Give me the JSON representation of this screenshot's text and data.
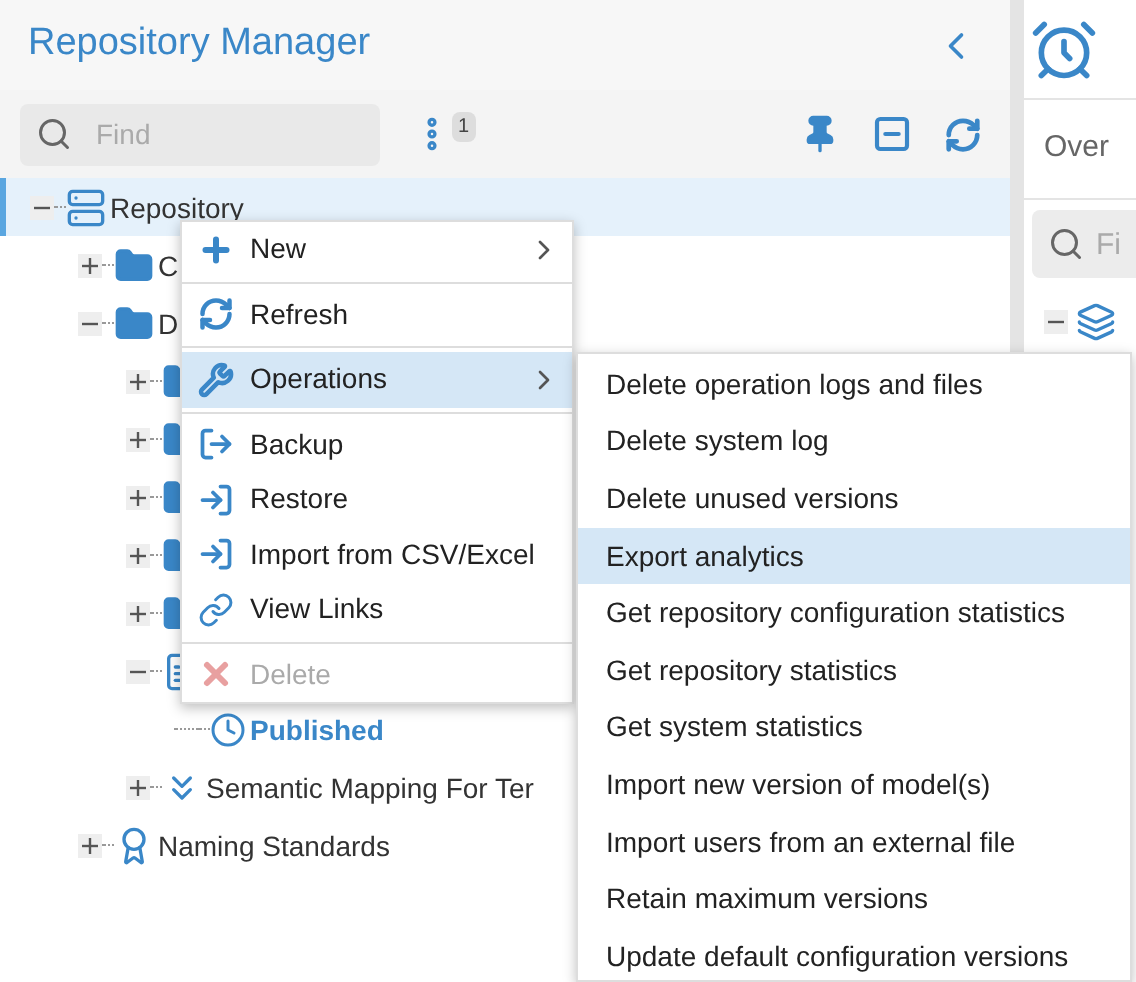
{
  "panel": {
    "title": "Repository Manager",
    "search": {
      "placeholder": "Find"
    },
    "filter_badge": "1"
  },
  "tree": [
    {
      "label": "Repository",
      "kind": "server",
      "expanded": true,
      "selected": true,
      "children": [
        {
          "label": "C",
          "kind": "folder",
          "expanded": false,
          "selected": false
        },
        {
          "label": "D",
          "kind": "folder",
          "expanded": true,
          "selected": false,
          "children": [
            {
              "kind": "folder",
              "expanded": false,
              "selected": false
            },
            {
              "kind": "folder",
              "expanded": false,
              "selected": false
            },
            {
              "kind": "folder",
              "expanded": false,
              "selected": false
            },
            {
              "kind": "folder",
              "expanded": false,
              "selected": false
            },
            {
              "kind": "folder",
              "expanded": false,
              "selected": false
            },
            {
              "kind": "model",
              "expanded": true,
              "selected": false,
              "children": [
                {
                  "label": "Published",
                  "kind": "version",
                  "selected": false
                }
              ]
            },
            {
              "label": "Semantic Mapping For Ter",
              "kind": "mapping",
              "expanded": false,
              "selected": false
            }
          ]
        },
        {
          "label": "Naming Standards",
          "kind": "standard",
          "expanded": false,
          "selected": false
        }
      ]
    }
  ],
  "right_panel": {
    "tab": "Over",
    "search": {
      "placeholder": "Fi"
    }
  },
  "context_menu": {
    "sections": [
      [
        {
          "label": "New",
          "kind": "new",
          "submenu": true,
          "selected": false,
          "disabled": false
        }
      ],
      [
        {
          "label": "Refresh",
          "kind": "refresh",
          "submenu": false,
          "selected": false,
          "disabled": false
        }
      ],
      [
        {
          "label": "Operations",
          "kind": "operations",
          "submenu": true,
          "selected": true,
          "disabled": false
        }
      ],
      [
        {
          "label": "Backup",
          "kind": "backup",
          "submenu": false,
          "selected": false,
          "disabled": false
        },
        {
          "label": "Restore",
          "kind": "restore",
          "submenu": false,
          "selected": false,
          "disabled": false
        },
        {
          "label": "Import from CSV/Excel",
          "kind": "import",
          "submenu": false,
          "selected": false,
          "disabled": false
        },
        {
          "label": "View Links",
          "kind": "links",
          "submenu": false,
          "selected": false,
          "disabled": false
        }
      ],
      [
        {
          "label": "Delete",
          "kind": "delete",
          "submenu": false,
          "selected": false,
          "disabled": true
        }
      ]
    ]
  },
  "submenu": [
    {
      "label": "Delete operation logs and files",
      "selected": false
    },
    {
      "label": "Delete system log",
      "selected": false
    },
    {
      "label": "Delete unused versions",
      "selected": false
    },
    {
      "label": "Export analytics",
      "selected": true
    },
    {
      "label": "Get repository configuration statistics",
      "selected": false
    },
    {
      "label": "Get repository statistics",
      "selected": false
    },
    {
      "label": "Get system statistics",
      "selected": false
    },
    {
      "label": "Import new version of model(s)",
      "selected": false
    },
    {
      "label": "Import users from an external file",
      "selected": false
    },
    {
      "label": "Retain maximum versions",
      "selected": false
    },
    {
      "label": "Update default configuration versions",
      "selected": false
    }
  ]
}
